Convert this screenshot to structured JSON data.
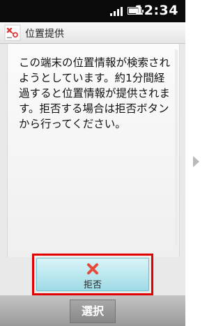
{
  "status_bar": {
    "time": "12:34",
    "icons": [
      "signal-icon",
      "battery-icon"
    ]
  },
  "title_bar": {
    "icon": "location-icon",
    "title": "位置提供"
  },
  "dialog": {
    "message": "この端末の位置情報が検索されようとしています。約1分間経過すると位置情報が提供されます。拒否する場合は拒否ボタンから行ってください。"
  },
  "actions": {
    "reject_label": "拒否",
    "reject_icon": "close-x-icon",
    "select_label": "選択"
  },
  "colors": {
    "highlight": "#e00000",
    "button_fill": "#a8dde7",
    "reject_icon_color": "#e64a3a",
    "title_icon_color": "#d83b3b"
  },
  "nav": {
    "next_icon": "chevron-right-icon"
  }
}
